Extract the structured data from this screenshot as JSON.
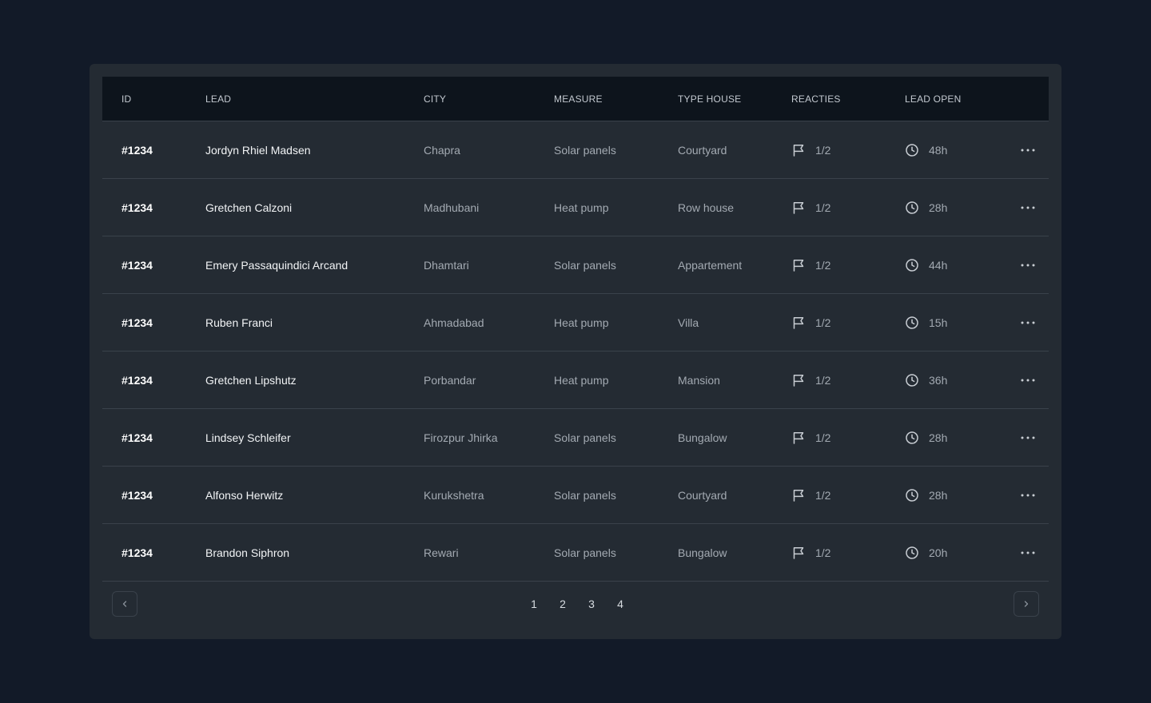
{
  "columns": {
    "id": "ID",
    "lead": "LEAD",
    "city": "CITY",
    "measure": "MEASURE",
    "type_house": "TYPE HOUSE",
    "reacties": "REACTIES",
    "lead_open": "LEAD OPEN"
  },
  "rows": [
    {
      "id": "#1234",
      "lead": "Jordyn Rhiel Madsen",
      "city": "Chapra",
      "measure": "Solar panels",
      "type_house": "Courtyard",
      "reacties": "1/2",
      "lead_open": "48h"
    },
    {
      "id": "#1234",
      "lead": "Gretchen Calzoni",
      "city": "Madhubani",
      "measure": "Heat pump",
      "type_house": "Row house",
      "reacties": "1/2",
      "lead_open": "28h"
    },
    {
      "id": "#1234",
      "lead": "Emery Passaquindici Arcand",
      "city": "Dhamtari",
      "measure": "Solar panels",
      "type_house": "Appartement",
      "reacties": "1/2",
      "lead_open": "44h"
    },
    {
      "id": "#1234",
      "lead": "Ruben Franci",
      "city": "Ahmadabad",
      "measure": "Heat pump",
      "type_house": "Villa",
      "reacties": "1/2",
      "lead_open": "15h"
    },
    {
      "id": "#1234",
      "lead": "Gretchen Lipshutz",
      "city": "Porbandar",
      "measure": "Heat pump",
      "type_house": "Mansion",
      "reacties": "1/2",
      "lead_open": "36h"
    },
    {
      "id": "#1234",
      "lead": "Lindsey Schleifer",
      "city": "Firozpur Jhirka",
      "measure": "Solar panels",
      "type_house": "Bungalow",
      "reacties": "1/2",
      "lead_open": "28h"
    },
    {
      "id": "#1234",
      "lead": "Alfonso Herwitz",
      "city": "Kurukshetra",
      "measure": "Solar panels",
      "type_house": "Courtyard",
      "reacties": "1/2",
      "lead_open": "28h"
    },
    {
      "id": "#1234",
      "lead": "Brandon Siphron",
      "city": "Rewari",
      "measure": "Solar panels",
      "type_house": "Bungalow",
      "reacties": "1/2",
      "lead_open": "20h"
    }
  ],
  "icons": {
    "reacties": "flag-icon",
    "lead_open": "clock-icon",
    "row_action": "more-horizontal-icon",
    "prev": "chevron-left-icon",
    "next": "chevron-right-icon"
  },
  "pagination": {
    "pages": [
      "1",
      "2",
      "3",
      "4"
    ]
  },
  "colors": {
    "background": "#121a28",
    "card": "#242b33",
    "header": "#0d141c",
    "divider": "#3a424b"
  }
}
